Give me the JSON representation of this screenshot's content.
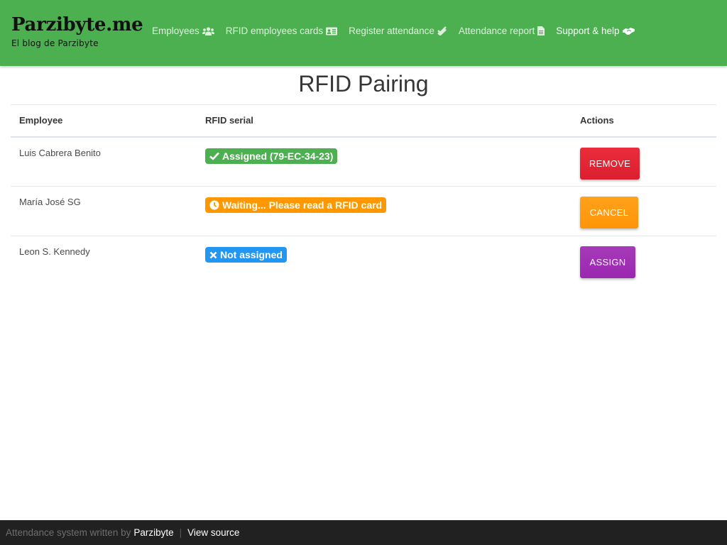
{
  "brand": {
    "title": "Parzibyte.me",
    "subtitle": "El blog de Parzibyte"
  },
  "nav": {
    "items": [
      {
        "label": "Employees",
        "icon": "users-icon"
      },
      {
        "label": "RFID employees cards",
        "icon": "id-card-icon"
      },
      {
        "label": "Register attendance",
        "icon": "double-check-icon"
      },
      {
        "label": "Attendance report",
        "icon": "file-icon"
      },
      {
        "label": "Support & help",
        "icon": "handshake-icon"
      }
    ]
  },
  "page": {
    "title": "RFID Pairing"
  },
  "table": {
    "headers": [
      "Employee",
      "RFID serial",
      "Actions"
    ],
    "rows": [
      {
        "employee": "Luis Cabrera Benito",
        "status": "Assigned (79-EC-34-23)",
        "status_type": "assigned",
        "action": "REMOVE"
      },
      {
        "employee": "María José SG",
        "status": "Waiting... Please read a RFID card",
        "status_type": "waiting",
        "action": "CANCEL"
      },
      {
        "employee": "Leon S. Kennedy",
        "status": "Not assigned",
        "status_type": "not-assigned",
        "action": "ASSIGN"
      }
    ]
  },
  "colors": {
    "navbar": "#4caf50",
    "assigned": "#4caf50",
    "waiting": "#ff9800",
    "not_assigned": "#2196f3",
    "remove": "#e32636",
    "cancel": "#ff9800",
    "assign": "#9c27b0",
    "footer": "#212121"
  },
  "footer": {
    "text": "Attendance system written by",
    "author_link": "Parzibyte",
    "separator": "|",
    "source_link": "View source"
  }
}
